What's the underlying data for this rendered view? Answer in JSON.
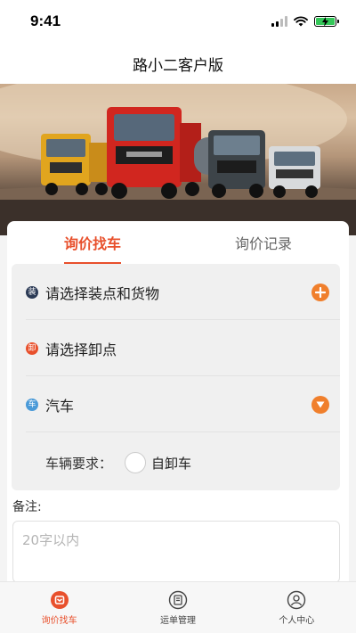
{
  "status_bar": {
    "time": "9:41"
  },
  "header": {
    "title": "路小二客户版"
  },
  "tabs": [
    {
      "label": "询价找车",
      "active": true
    },
    {
      "label": "询价记录",
      "active": false
    }
  ],
  "form": {
    "loading": {
      "badge": "装",
      "label": "请选择装点和货物",
      "badge_color": "#2b3a55",
      "icon": "plus-icon"
    },
    "unloading": {
      "badge": "卸",
      "label": "请选择卸点",
      "badge_color": "#e8502c"
    },
    "vehicle": {
      "badge": "车",
      "label": "汽车",
      "badge_color": "#4a9ad8",
      "icon": "chevron-down-icon"
    },
    "requirement": {
      "label": "车辆要求：",
      "option": "自卸车",
      "checked": false
    }
  },
  "remark": {
    "label": "备注:",
    "placeholder": "20字以内",
    "value": ""
  },
  "bottom_nav": [
    {
      "label": "询价找车",
      "icon": "inquiry-icon",
      "active": true
    },
    {
      "label": "运单管理",
      "icon": "waybill-icon",
      "active": false
    },
    {
      "label": "个人中心",
      "icon": "user-icon",
      "active": false
    }
  ],
  "colors": {
    "accent": "#e8502c",
    "orange_button": "#f07f2c"
  },
  "banner": {
    "image": "truck-fleet-photo"
  }
}
